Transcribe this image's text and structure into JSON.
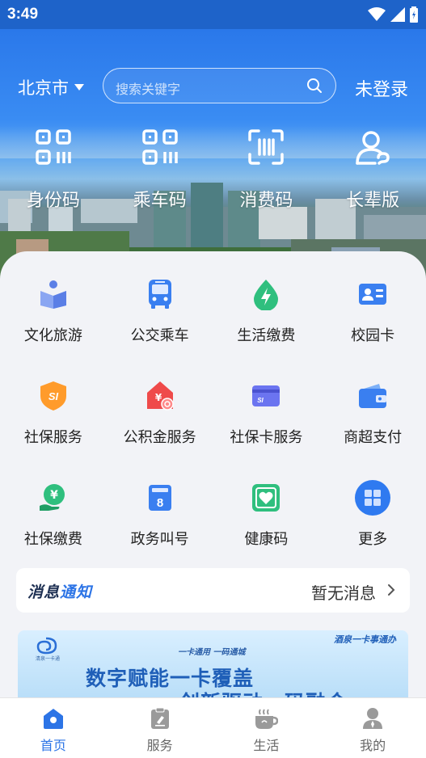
{
  "status_bar": {
    "time": "3:49"
  },
  "header": {
    "city": "北京市",
    "search_placeholder": "搜索关键字",
    "login": "未登录"
  },
  "quick_actions": [
    {
      "label": "身份码",
      "icon": "qr-code-icon"
    },
    {
      "label": "乘车码",
      "icon": "qr-code-icon"
    },
    {
      "label": "消费码",
      "icon": "scan-barcode-icon"
    },
    {
      "label": "长辈版",
      "icon": "elder-user-icon"
    }
  ],
  "services": [
    {
      "label": "文化旅游",
      "icon": "culture-travel-icon"
    },
    {
      "label": "公交乘车",
      "icon": "bus-icon"
    },
    {
      "label": "生活缴费",
      "icon": "utility-payment-icon"
    },
    {
      "label": "校园卡",
      "icon": "campus-card-icon"
    },
    {
      "label": "社保服务",
      "icon": "social-security-icon"
    },
    {
      "label": "公积金服务",
      "icon": "housing-fund-icon"
    },
    {
      "label": "社保卡服务",
      "icon": "social-security-card-icon"
    },
    {
      "label": "商超支付",
      "icon": "wallet-icon"
    },
    {
      "label": "社保缴费",
      "icon": "social-security-payment-icon"
    },
    {
      "label": "政务叫号",
      "icon": "queue-number-icon"
    },
    {
      "label": "健康码",
      "icon": "health-code-icon"
    },
    {
      "label": "更多",
      "icon": "more-grid-icon"
    }
  ],
  "message": {
    "title_part1": "消息",
    "title_part2": "通知",
    "status": "暂无消息"
  },
  "banner": {
    "subtitle": "一卡通用 一码通城",
    "line1": "数字赋能一卡覆盖",
    "line2": "创新驱动一码融合",
    "brand_text": "清泉一卡通",
    "slogan": "酒泉一卡事通办"
  },
  "nav": [
    {
      "label": "首页",
      "icon": "home-icon",
      "active": true
    },
    {
      "label": "服务",
      "icon": "service-icon",
      "active": false
    },
    {
      "label": "生活",
      "icon": "life-icon",
      "active": false
    },
    {
      "label": "我的",
      "icon": "profile-icon",
      "active": false
    }
  ],
  "colors": {
    "primary": "#2c74e6",
    "status_bar": "#1e63c9"
  }
}
